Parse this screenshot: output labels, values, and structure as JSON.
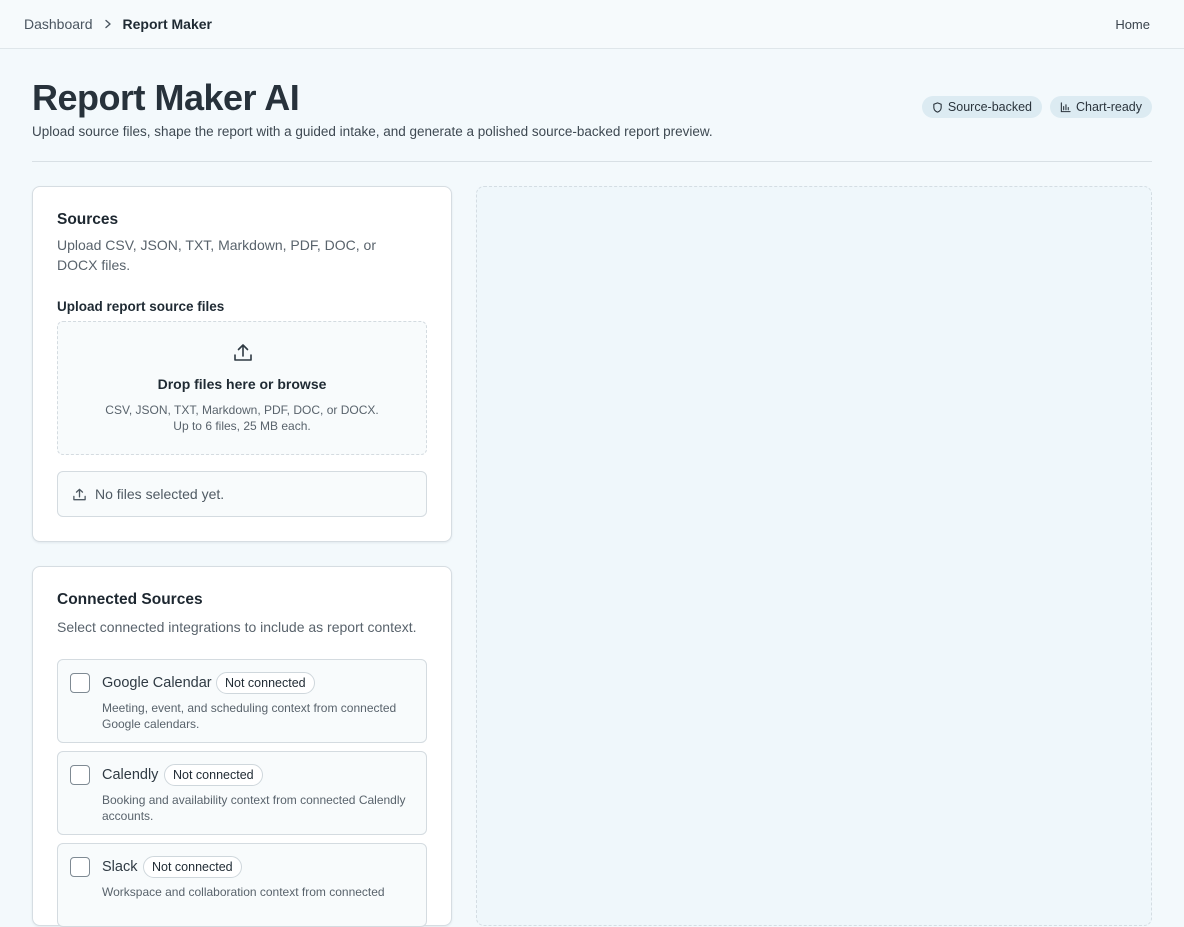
{
  "breadcrumb": {
    "parent": "Dashboard",
    "current": "Report Maker"
  },
  "nav": {
    "home": "Home"
  },
  "header": {
    "title": "Report Maker AI",
    "subtitle": "Upload source files, shape the report with a guided intake, and generate a polished source-backed report preview.",
    "badges": [
      {
        "label": "Source-backed",
        "icon": "shield-icon"
      },
      {
        "label": "Chart-ready",
        "icon": "bar-chart-icon"
      }
    ]
  },
  "sources": {
    "title": "Sources",
    "description": "Upload CSV, JSON, TXT, Markdown, PDF, DOC, or DOCX files.",
    "upload_label": "Upload report source files",
    "dropzone": {
      "title": "Drop files here or browse",
      "hint": "CSV, JSON, TXT, Markdown, PDF, DOC, or DOCX. Up to 6 files, 25 MB each.",
      "icon": "upload-icon"
    },
    "status": "No files selected yet."
  },
  "connected": {
    "title": "Connected Sources",
    "description": "Select connected integrations to include as report context.",
    "items": [
      {
        "name": "Google Calendar",
        "status": "Not connected",
        "description": "Meeting, event, and scheduling context from connected Google calendars.",
        "checked": false
      },
      {
        "name": "Calendly",
        "status": "Not connected",
        "description": "Booking and availability context from connected Calendly accounts.",
        "checked": false
      },
      {
        "name": "Slack",
        "status": "Not connected",
        "description": "Workspace and collaboration context from connected",
        "checked": false
      }
    ]
  }
}
